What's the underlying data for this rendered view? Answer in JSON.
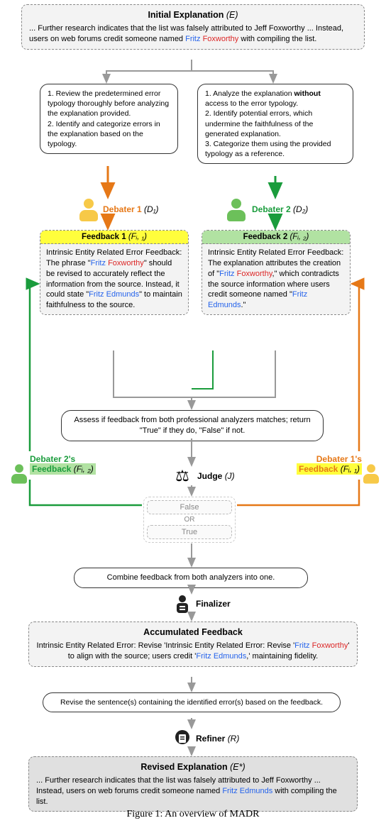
{
  "initial": {
    "title": "Initial Explanation",
    "sym": "(E)",
    "body_a": "... Further research indicates that the list was falsely attributed to Jeff Foxworthy ... Instead, users on web forums credit someone named ",
    "fritz": "Fritz",
    "fox": "Foxworthy",
    "body_b": " with compiling the list."
  },
  "deb1_prompt": "1. Review the predetermined error typology thoroughly before analyzing the explanation provided.\n2. Identify and categorize errors in the explanation based on the typology.",
  "deb2_prompt_a": "1. Analyze the explanation ",
  "deb2_prompt_bold": "without",
  "deb2_prompt_b": " access to the error typology.\n2. Identify potential errors, which undermine the faithfulness of the generated explanation.\n3. Categorize them using the provided typology as a reference.",
  "deb1_label": "Debater 1",
  "deb1_sym": "(D₁)",
  "deb2_label": "Debater 2",
  "deb2_sym": "(D₂)",
  "fb1": {
    "title": "Feedback 1",
    "sym": "(Fᵢ, ₁)",
    "body_a": "Intrinsic Entity Related Error Feedback: The phrase \"",
    "body_b": "\" should be revised to accurately reflect the information from the source. Instead, it could state \"",
    "edm": "Fritz Edmunds",
    "body_c": "\" to maintain faithfulness to the source."
  },
  "fb2": {
    "title": "Feedback 2",
    "sym": "(Fᵢ, ₂)",
    "body_a": "Intrinsic Entity Related Error Feedback: The explanation attributes the creation of \"",
    "body_b": ",\" which contradicts the source information where users credit someone named \"",
    "edm": "Fritz Edmunds",
    "body_c": ".\""
  },
  "assess": "Assess if feedback from both professional analyzers matches; return \"True\" if they do, \"False\" if not.",
  "judge_label": "Judge",
  "judge_sym": "(J)",
  "tf_false": "False",
  "tf_or": "OR",
  "tf_true": "True",
  "deb2_fb_label": "Debater 2's",
  "deb2_fb_label2": "Feedback",
  "deb2_fb_sym": "(Fᵢ, ₂)",
  "deb1_fb_label": "Debater 1's",
  "deb1_fb_label2": "Feedback",
  "deb1_fb_sym": "(Fᵢ, ₁)",
  "combine": "Combine feedback from both analyzers into one.",
  "finalizer_label": "Finalizer",
  "accum": {
    "title": "Accumulated Feedback",
    "body_a": "Intrinsic Entity Related Error: Revise 'Intrinsic Entity Related Error: Revise '",
    "body_b": "' to align with the source; users credit '",
    "edm": "Fritz Edmunds",
    "body_c": ",' maintaining fidelity."
  },
  "revise": "Revise the sentence(s) containing the identified error(s) based on the feedback.",
  "refiner_label": "Refiner",
  "refiner_sym": "(R)",
  "revised": {
    "title": "Revised Explanation",
    "sym": "(E*)",
    "body_a": "... Further research indicates that the list was falsely attributed to Jeff Foxworthy ... Instead, users on web forums credit someone named ",
    "edm": "Fritz Edmunds",
    "body_b": " with compiling the list."
  },
  "caption": "Figure 1: An overview of MADR"
}
